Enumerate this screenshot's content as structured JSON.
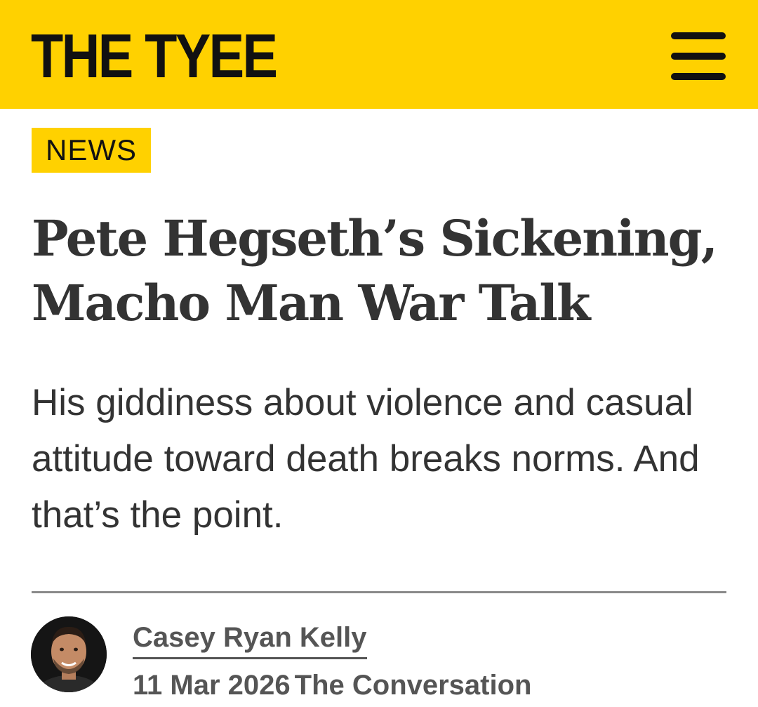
{
  "header": {
    "logo_text": "THE TYEE",
    "menu_icon": "hamburger-menu-icon",
    "brand_color": "#FFD100"
  },
  "article": {
    "section_tag": "NEWS",
    "title": "Pete Hegseth’s Sickening, Macho Man War Talk",
    "dek": "His giddiness about violence and casual attitude toward death breaks norms. And that’s the point.",
    "byline": {
      "author": "Casey Ryan Kelly",
      "date": "11 Mar 2026",
      "source": "The Conversation"
    }
  }
}
